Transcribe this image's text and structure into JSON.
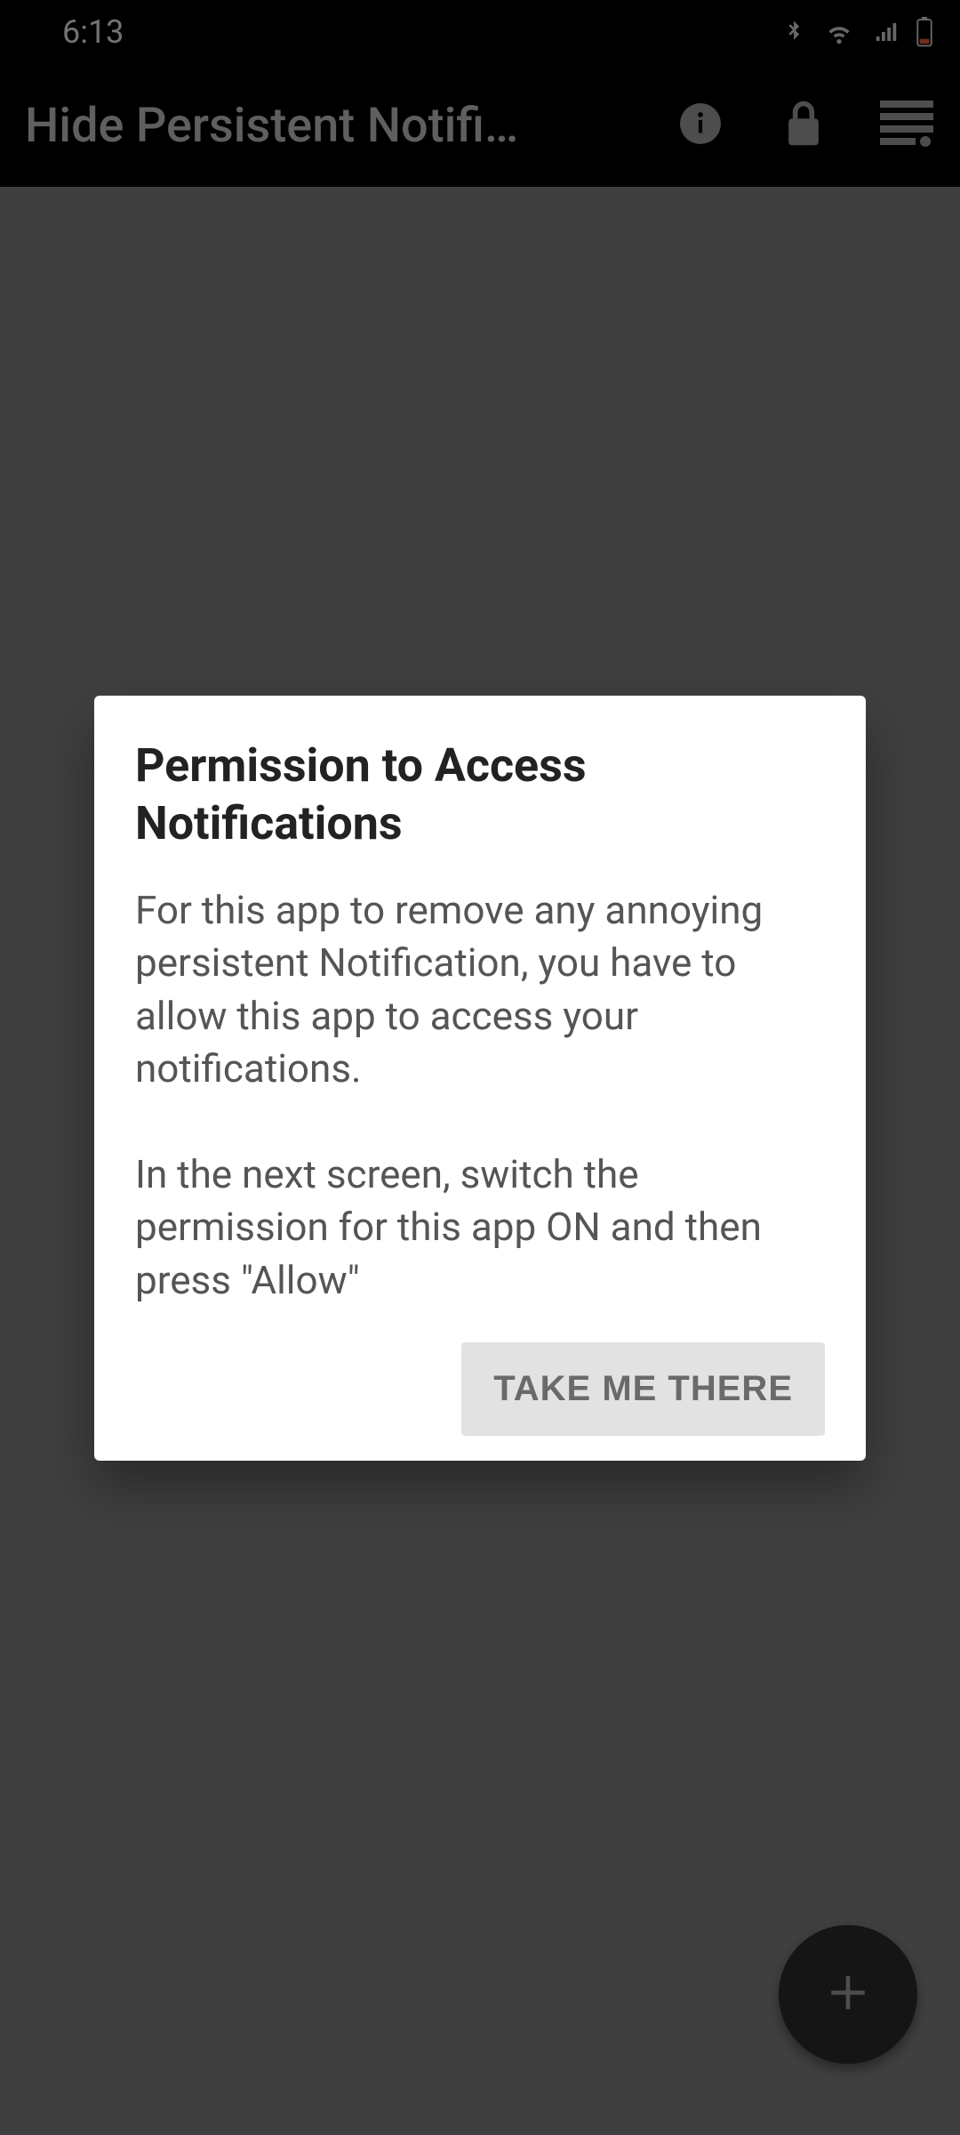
{
  "status": {
    "time": "6:13",
    "icons": [
      "bluetooth",
      "wifi",
      "signal",
      "battery-low"
    ]
  },
  "appbar": {
    "title": "Hide Persistent Notifi…",
    "actions": {
      "info": "info-icon",
      "lock": "lock-icon",
      "log": "list-icon"
    }
  },
  "fab": {
    "icon": "plus"
  },
  "dialog": {
    "title": "Permission to Access Notifications",
    "body": "For this app to remove any annoying persistent Notification, you have to allow this app to access your notifications.\n\nIn the next screen, switch the permission for this app ON and then press \"Allow\"",
    "confirm": "TAKE ME THERE"
  }
}
